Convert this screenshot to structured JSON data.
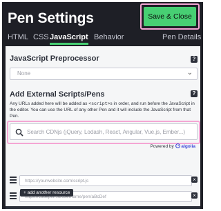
{
  "header": {
    "title": "Pen Settings",
    "save_label": "Save & Close",
    "accent_color": "#47cf73",
    "highlight_color": "#f4a6d4"
  },
  "tabs": [
    {
      "label": "HTML",
      "active": false
    },
    {
      "label": "CSS",
      "active": false
    },
    {
      "label": "JavaScript",
      "active": true
    },
    {
      "label": "Behavior",
      "active": false
    },
    {
      "label": "Pen Details",
      "active": false
    }
  ],
  "preprocessor": {
    "title": "JavaScript Preprocessor",
    "help": "?",
    "selected": "None",
    "chevron": "⌄"
  },
  "external": {
    "title": "Add External Scripts/Pens",
    "help": "?",
    "desc_part1": "Any URLs added here will be added as ",
    "desc_code": "<script>",
    "desc_part2": "s in order, and run before the JavaScript in the editor. You can use the URL of any other Pen and it will include the JavaScript from that Pen.",
    "search_placeholder": "Search CDNjs (jQuery, Lodash, React, Angular, Vue.js, Ember...)",
    "search_icon": "search-icon",
    "powered_by": "Powered by",
    "powered_brand": "algolia",
    "resources": [
      {
        "placeholder": "https://yourwebsite.com/script.js",
        "value": ""
      },
      {
        "placeholder": "https://codepen.io/username/pen/aBcDef",
        "value": ""
      }
    ],
    "remove_label": "×",
    "add_label": "+ add another resource"
  }
}
